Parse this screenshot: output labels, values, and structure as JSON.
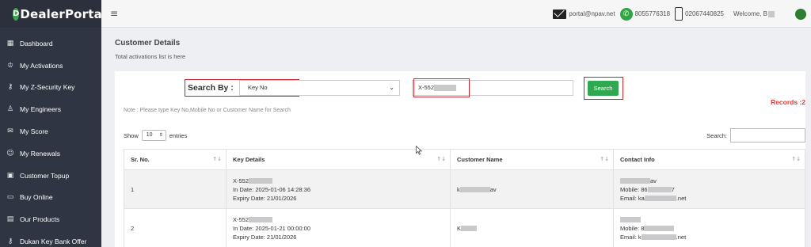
{
  "brand": {
    "logo_mark": "D",
    "name": "DealerPortal"
  },
  "sidebar": {
    "items": [
      {
        "icon": "dashboard-icon",
        "glyph": "▦",
        "label": "Dashboard"
      },
      {
        "icon": "crown-icon",
        "glyph": "♔",
        "label": "My Activations"
      },
      {
        "icon": "key-icon",
        "glyph": "⚷",
        "label": "My Z-Security Key"
      },
      {
        "icon": "user-icon",
        "glyph": "♙",
        "label": "My Engineers"
      },
      {
        "icon": "scorecard-icon",
        "glyph": "✉",
        "label": "My Score"
      },
      {
        "icon": "renew-icon",
        "glyph": "☺",
        "label": "My Renewals"
      },
      {
        "icon": "calendar-icon",
        "glyph": "▣",
        "label": "Customer Topup"
      },
      {
        "icon": "card-icon",
        "glyph": "▭",
        "label": "Buy Online"
      },
      {
        "icon": "products-icon",
        "glyph": "▤",
        "label": "Our Products"
      },
      {
        "icon": "key-offer-icon",
        "glyph": "⚷",
        "label": "Dukan Key Bank Offer"
      }
    ]
  },
  "header": {
    "menu_glyph": "≡",
    "email": "portal@npav.net",
    "whatsapp": "8055776318",
    "phone": "02067440825",
    "welcome": "Welcome, B"
  },
  "page": {
    "title": "Customer Details",
    "subtitle": "Total activations list is here"
  },
  "search": {
    "label": "Search By :",
    "selected": "Key No",
    "keyword_value": "X-552",
    "button": "Search",
    "records": "Records :2",
    "note": "Note : Please type Key No,Mobile No or Customer Name for Search"
  },
  "table_controls": {
    "show": "Show",
    "entries_value": "10",
    "entries": "entries",
    "search_label": "Search:"
  },
  "table": {
    "headers": [
      "Sr. No.",
      "Key Details",
      "Customer Name",
      "Contact Info"
    ],
    "rows": [
      {
        "sr": "1",
        "key": "X-552",
        "in_date": "In Date: 2025-01-06 14:28:36",
        "expiry": "Expiry Date: 21/01/2026",
        "customer_prefix": "k",
        "customer_suffix": "av",
        "contact_name_suffix": "av",
        "mobile_prefix": "Mobile: 86",
        "mobile_suffix": "7",
        "email_prefix": "Email: ka",
        "email_suffix": ".net"
      },
      {
        "sr": "2",
        "key": "X-552",
        "in_date": "In Date: 2025-01-21 00:00:00",
        "expiry": "Expiry Date: 21/01/2026",
        "customer_prefix": "K",
        "customer_suffix": "",
        "contact_name_suffix": "",
        "mobile_prefix": "Mobile: 8",
        "mobile_suffix": "",
        "email_prefix": "Email: k",
        "email_suffix": ".net"
      }
    ]
  },
  "colors": {
    "sidebar": "#303543",
    "accent_green": "#2fa84f",
    "highlight_red": "#c8262c",
    "records_red": "#e53935"
  }
}
